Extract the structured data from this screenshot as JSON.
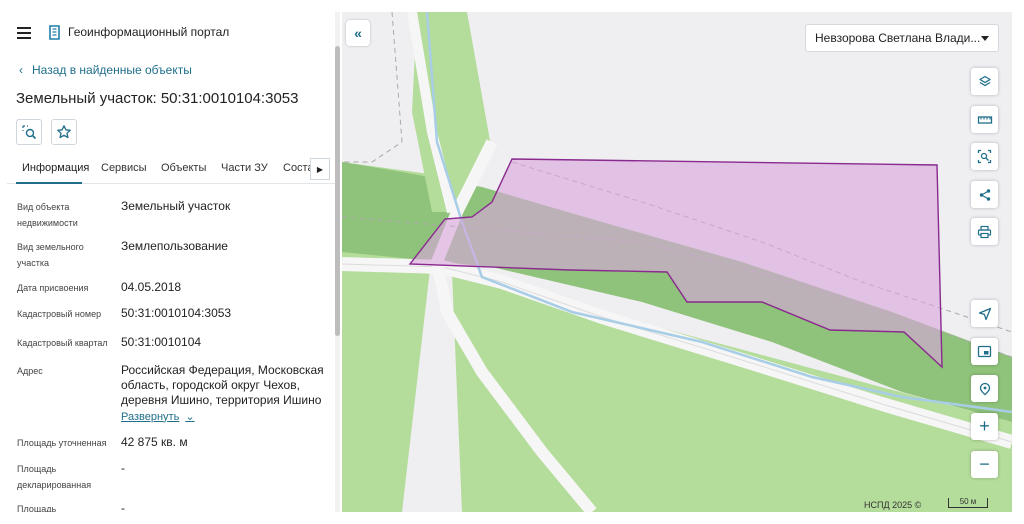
{
  "header": {
    "portal_title": "Геоинформационный портал"
  },
  "nav": {
    "back_label": "Назад в найденные объекты",
    "back_chevron": "‹"
  },
  "object": {
    "title": "Земельный участок: 50:31:0010104:3053"
  },
  "tabs": [
    {
      "label": "Информация",
      "active": true
    },
    {
      "label": "Сервисы"
    },
    {
      "label": "Объекты"
    },
    {
      "label": "Части ЗУ"
    },
    {
      "label": "Соста"
    }
  ],
  "tab_scroll_glyph": "▶",
  "properties": [
    {
      "label": "Вид объекта недвижимости",
      "value": "Земельный участок"
    },
    {
      "label": "Вид земельного участка",
      "value": "Землепользование"
    },
    {
      "label": "Дата присвоения",
      "value": "04.05.2018"
    },
    {
      "label": "Кадастровый номер",
      "value": "50:31:0010104:3053"
    },
    {
      "label": "Кадастровый квартал",
      "value": "50:31:0010104"
    },
    {
      "label": "Адрес",
      "value": "Российская Федерация, Московская область, городской округ Чехов, деревня Ишино, территория Ишино"
    },
    {
      "label": "Площадь уточненная",
      "value": "42 875 кв. м"
    },
    {
      "label": "Площадь декларированная",
      "value": "-"
    },
    {
      "label": "Площадь",
      "value": "-"
    }
  ],
  "expand_label": "Развернуть",
  "expand_chevron": "⌄",
  "map": {
    "collapse_glyph": "«",
    "user_name": "Невзорова Светлана Влади...",
    "tools": [
      "layers-icon",
      "ruler-icon",
      "select-area-icon",
      "share-icon",
      "print-icon",
      "locate-icon",
      "minimap-icon",
      "geolocation-icon",
      "zoom-in-icon",
      "zoom-out-icon"
    ],
    "zoom_in_glyph": "+",
    "zoom_out_glyph": "−",
    "attribution": "НСПД 2025 ©",
    "scale_label": "50 м",
    "parcel_fill": "#d9a6dc",
    "parcel_stroke": "#8a2a8e",
    "green_dark": "#8fc27a",
    "green_light": "#b4dc9a",
    "water": "#a8cde6"
  }
}
